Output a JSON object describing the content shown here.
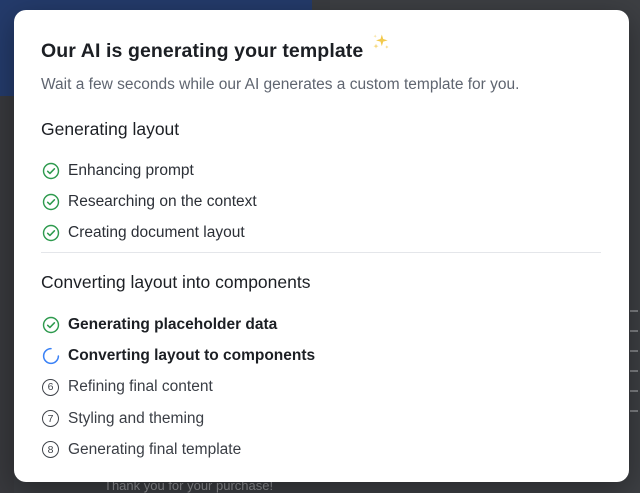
{
  "background": {
    "footer_text": "Thank you for your purchase!"
  },
  "modal": {
    "title": "Our AI is generating your template",
    "title_icon": "sparkles-icon",
    "subtitle": "Wait a few seconds while our AI generates a custom template for you.",
    "sections": [
      {
        "title": "Generating layout",
        "steps": [
          {
            "label": "Enhancing prompt",
            "status": "done"
          },
          {
            "label": "Researching on the context",
            "status": "done"
          },
          {
            "label": "Creating document layout",
            "status": "done"
          }
        ]
      },
      {
        "title": "Converting layout into components",
        "steps": [
          {
            "label": "Generating placeholder data",
            "status": "done"
          },
          {
            "label": "Converting layout to components",
            "status": "in-progress"
          },
          {
            "label": "Refining final content",
            "status": "pending",
            "number": "6"
          },
          {
            "label": "Styling and theming",
            "status": "pending",
            "number": "7"
          },
          {
            "label": "Generating final template",
            "status": "pending",
            "number": "8"
          }
        ]
      }
    ]
  },
  "colors": {
    "done": "#2e9a4e",
    "in_progress": "#3b82f6",
    "pending": "#3f434a",
    "sparkle": "#f2c94c"
  }
}
